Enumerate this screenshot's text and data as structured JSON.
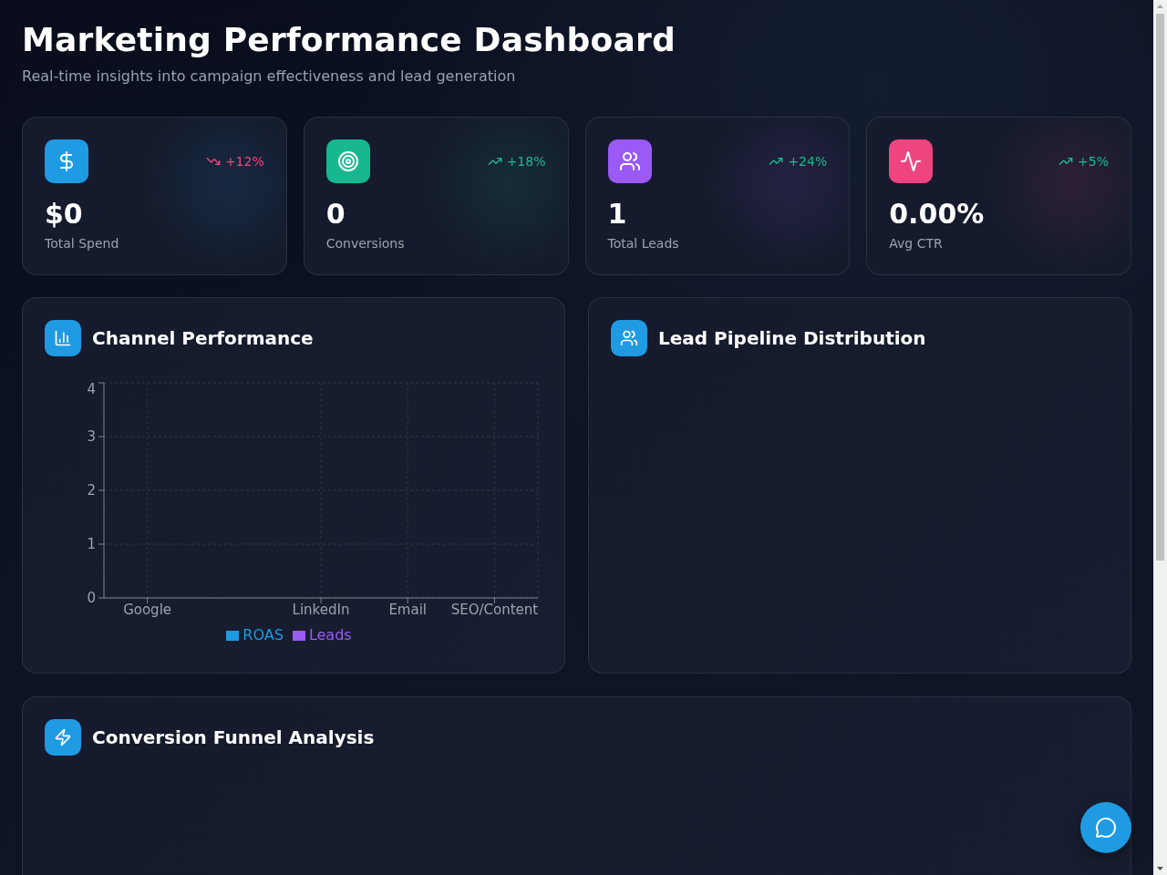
{
  "header": {
    "title": "Marketing Performance Dashboard",
    "subtitle": "Real-time insights into campaign effectiveness and lead generation"
  },
  "stats": [
    {
      "value": "$0",
      "label": "Total Spend",
      "change": "+12%",
      "declining": true,
      "color": "#1f9be3"
    },
    {
      "value": "0",
      "label": "Conversions",
      "change": "+18%",
      "declining": false,
      "color": "#17b890"
    },
    {
      "value": "1",
      "label": "Total Leads",
      "change": "+24%",
      "declining": false,
      "color": "#9b59f6"
    },
    {
      "value": "0.00%",
      "label": "Avg CTR",
      "change": "+5%",
      "declining": false,
      "color": "#ee4580"
    }
  ],
  "panels": [
    {
      "title": "Channel Performance",
      "chart_data": {
        "type": "bar",
        "categories": [
          "Google",
          null,
          "LinkedIn",
          "Email",
          "SEO/Content"
        ],
        "series": [
          {
            "name": "ROAS",
            "color": "#1e9be0",
            "values": [
              0,
              0,
              0,
              0,
              0
            ]
          },
          {
            "name": "Leads",
            "color": "#9b5cf6",
            "values": [
              0,
              0,
              0,
              0,
              0
            ]
          }
        ],
        "ylim": [
          0,
          4
        ],
        "yticks": [
          {
            "value": 0,
            "label": "0"
          },
          {
            "value": 1,
            "label": "1"
          },
          {
            "value": 2,
            "label": "2"
          },
          {
            "value": 3,
            "label": "3"
          },
          {
            "value": 4,
            "label": "4"
          }
        ],
        "grid": true,
        "legend": "bottom"
      }
    },
    {
      "title": "Lead Pipeline Distribution"
    },
    {
      "title": "Conversion Funnel Analysis"
    }
  ]
}
